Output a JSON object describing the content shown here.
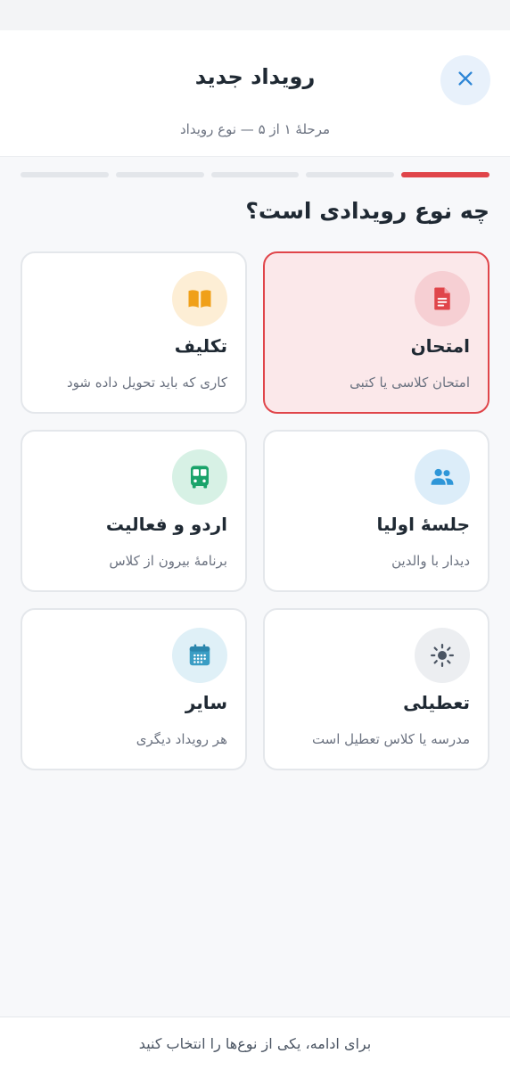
{
  "header": {
    "title": "رویداد جدید",
    "subtitle": "مرحلهٔ ۱ از ۵ — نوع رویداد",
    "close_icon": "close-icon"
  },
  "progress": {
    "total_steps": 5,
    "current_step": 1,
    "active_color": "#e0454a"
  },
  "question": "چه نوع رویدادی است؟",
  "event_types": [
    {
      "title": "امتحان",
      "desc": "امتحان کلاسی یا کتبی",
      "icon": "document-icon",
      "icon_color": "#e0454a",
      "icon_bg": "#f6cfd3",
      "selected": true
    },
    {
      "title": "تکلیف",
      "desc": "کاری که باید تحویل داده شود",
      "icon": "book-icon",
      "icon_color": "#f0a019",
      "icon_bg": "#fdeed5",
      "selected": false
    },
    {
      "title": "جلسهٔ اولیا",
      "desc": "دیدار با والدین",
      "icon": "people-icon",
      "icon_color": "#2e96d8",
      "icon_bg": "#dcedf9",
      "selected": false
    },
    {
      "title": "اردو و فعالیت",
      "desc": "برنامهٔ بیرون از کلاس",
      "icon": "bus-icon",
      "icon_color": "#1aa36a",
      "icon_bg": "#d7f1e5",
      "selected": false
    },
    {
      "title": "تعطیلی",
      "desc": "مدرسه یا کلاس تعطیل است",
      "icon": "sun-icon",
      "icon_color": "#4b5563",
      "icon_bg": "#eceef1",
      "selected": false
    },
    {
      "title": "سایر",
      "desc": "هر رویداد دیگری",
      "icon": "calendar-icon",
      "icon_color": "#3a9dc4",
      "icon_bg": "#dff0f7",
      "selected": false
    }
  ],
  "footer": {
    "hint": "برای ادامه، یکی از نوع‌ها را انتخاب کنید"
  }
}
